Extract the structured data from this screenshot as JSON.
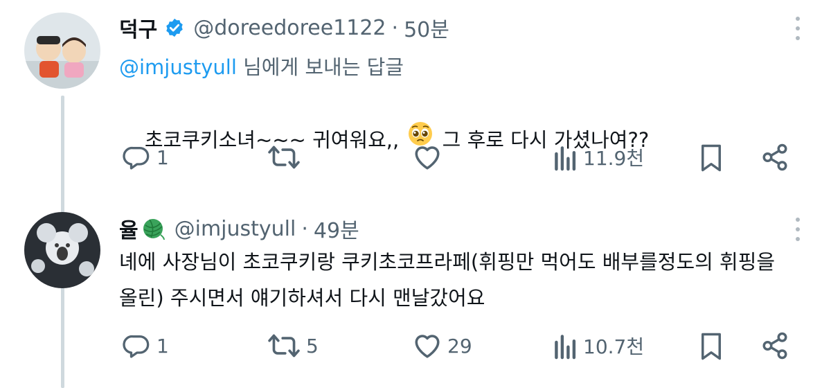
{
  "tweets": [
    {
      "display_name": "덕구",
      "handle": "@doreedoree1122",
      "separator": "·",
      "time": "50분",
      "replying_to": "@imjustyull",
      "replying_suffix": " 님에게 보내는 답글",
      "text_before_emoji": "초코쿠키소녀~~~ 귀여워요,, ",
      "emoji": "pleading-face",
      "text_after_emoji": " 그 후로 다시 가셨나여??",
      "reply_count": "1",
      "retweet_count": "",
      "like_count": "",
      "view_count": "11.9천",
      "verified": true
    },
    {
      "display_name": "율",
      "handle": "@imjustyull",
      "separator": "·",
      "time": "49분",
      "text": "녜에 사장님이 초코쿠키랑 쿠키초코프라페(휘핑만 먹어도 배부를정도의 휘핑을\n올린) 주시면서 얘기하셔서 다시 맨날갔어요",
      "reply_count": "1",
      "retweet_count": "5",
      "like_count": "29",
      "view_count": "10.7천"
    }
  ],
  "colors": {
    "text": "#0f1419",
    "secondary": "#536471",
    "link": "#1d9bf0",
    "thread_line": "#cfd9de"
  }
}
